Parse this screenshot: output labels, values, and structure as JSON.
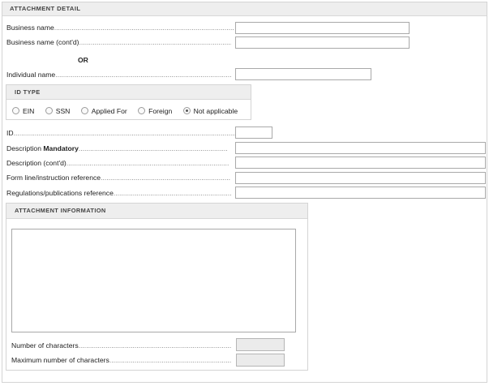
{
  "panel": {
    "title": "ATTACHMENT DETAIL"
  },
  "fields": {
    "business_name": {
      "label": "Business name",
      "value": ""
    },
    "business_name_contd": {
      "label": "Business name (cont'd)",
      "value": ""
    },
    "or_text": "OR",
    "individual_name": {
      "label": "Individual name",
      "value": ""
    },
    "id": {
      "label": "ID",
      "value": ""
    },
    "description": {
      "label": "Description",
      "mandatory": "Mandatory",
      "value": ""
    },
    "description_contd": {
      "label": "Description (cont'd)",
      "value": ""
    },
    "form_line": {
      "label": "Form line/instruction reference",
      "value": ""
    },
    "regulations": {
      "label": "Regulations/publications reference",
      "value": ""
    }
  },
  "id_type": {
    "title": "ID TYPE",
    "options": [
      "EIN",
      "SSN",
      "Applied For",
      "Foreign",
      "Not applicable"
    ],
    "selected": "Not applicable"
  },
  "attachment_info": {
    "title": "ATTACHMENT INFORMATION",
    "text": "",
    "num_chars": {
      "label": "Number of characters",
      "value": ""
    },
    "max_chars": {
      "label": "Maximum number of characters",
      "value": ""
    }
  }
}
